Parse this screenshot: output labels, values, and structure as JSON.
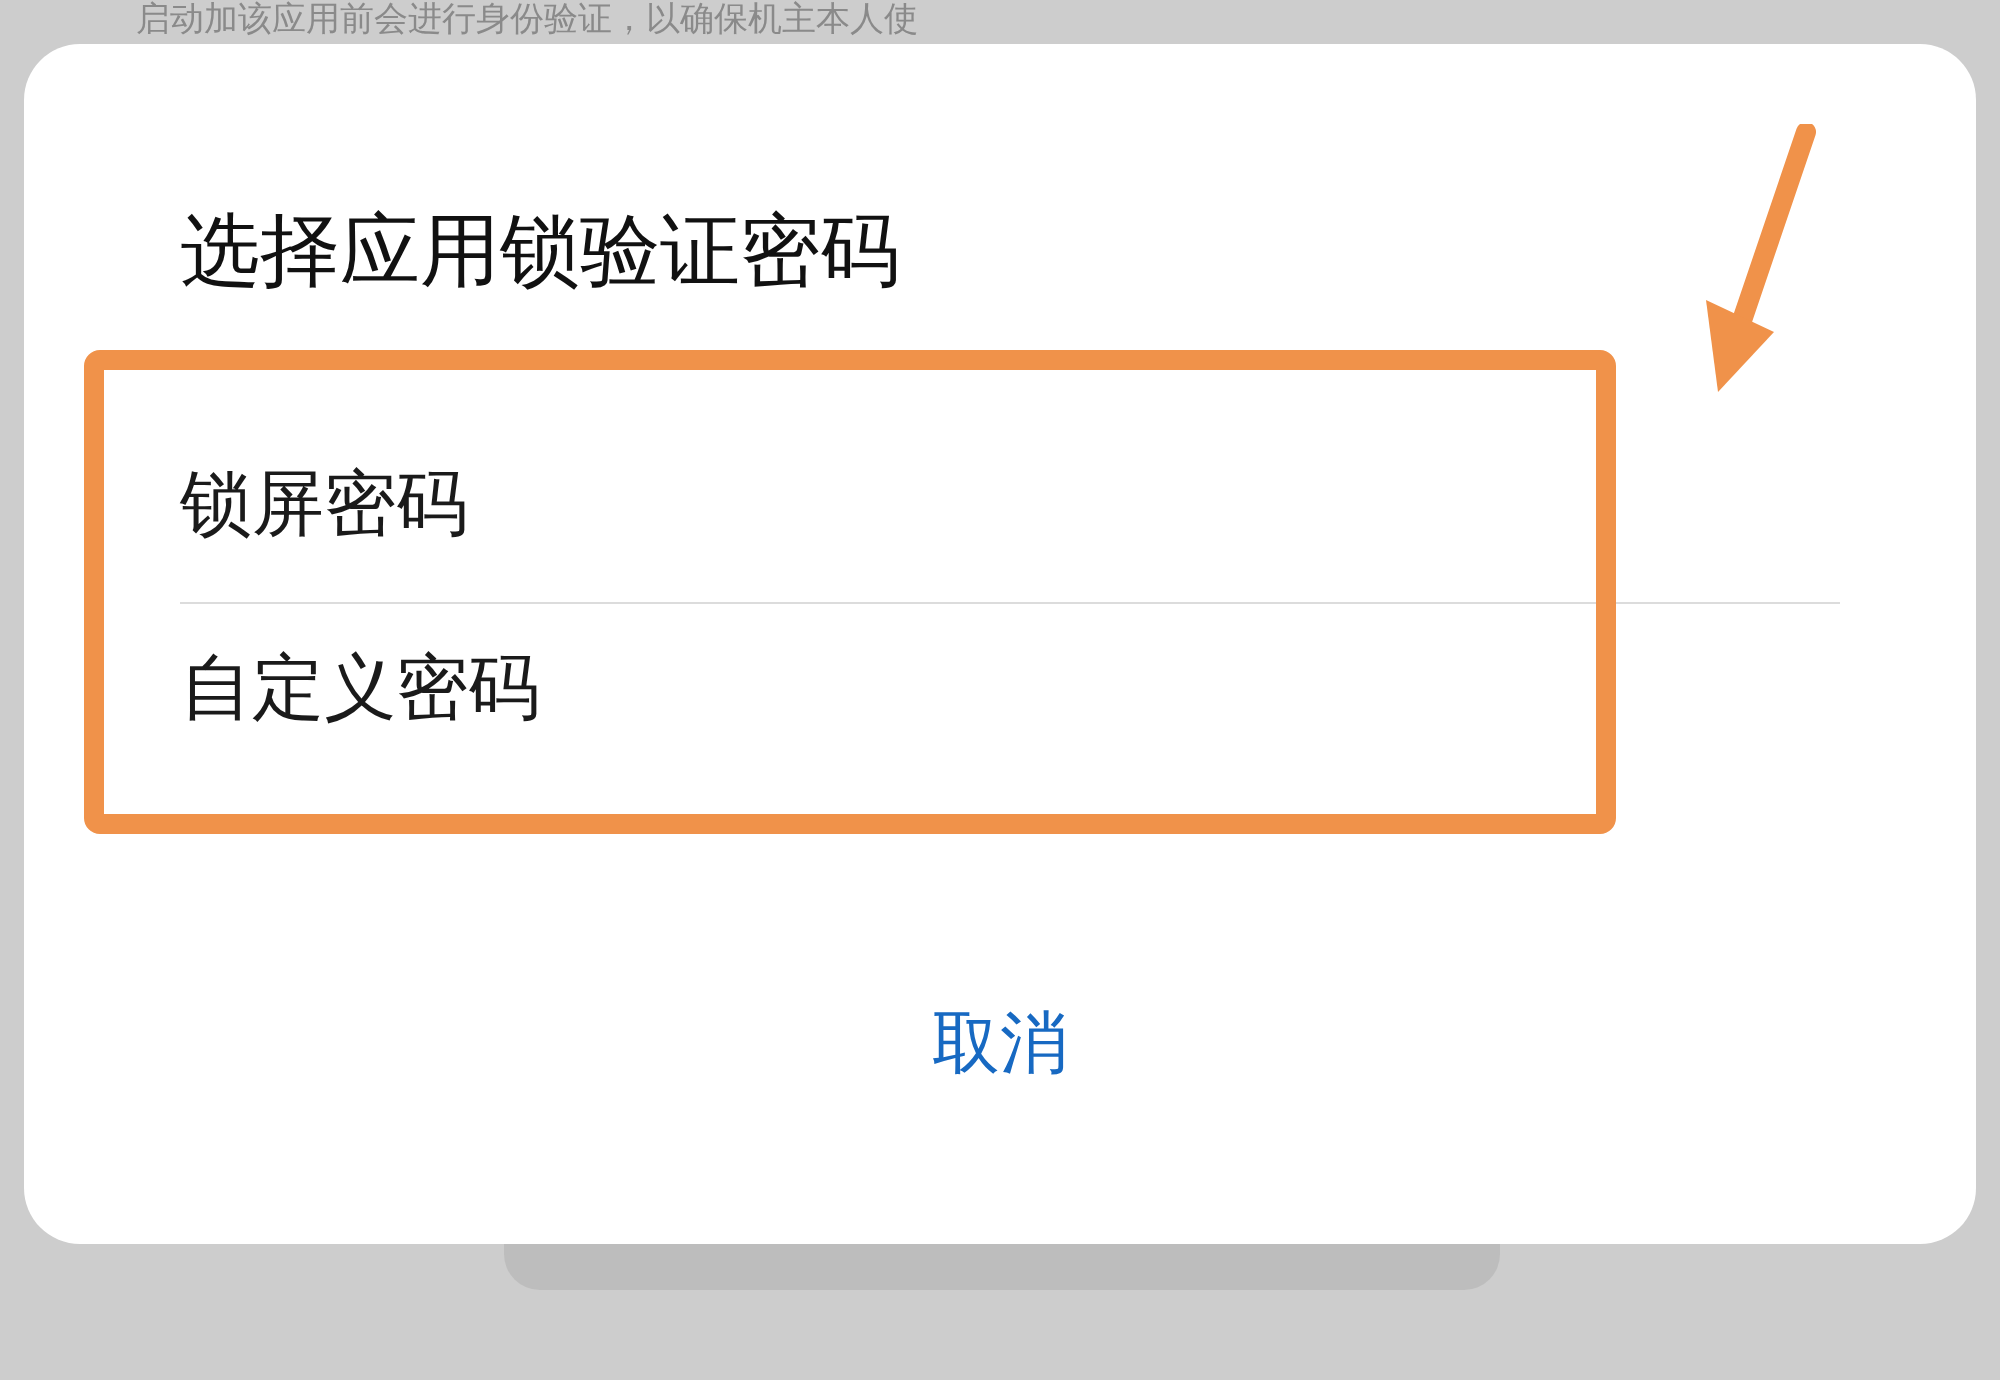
{
  "background_text": "启动加该应用前会进行身份验证，以确保机主本人使",
  "dialog": {
    "title": "选择应用锁验证密码",
    "options": [
      {
        "label": "锁屏密码"
      },
      {
        "label": "自定义密码"
      }
    ],
    "cancel_button": "取消"
  }
}
